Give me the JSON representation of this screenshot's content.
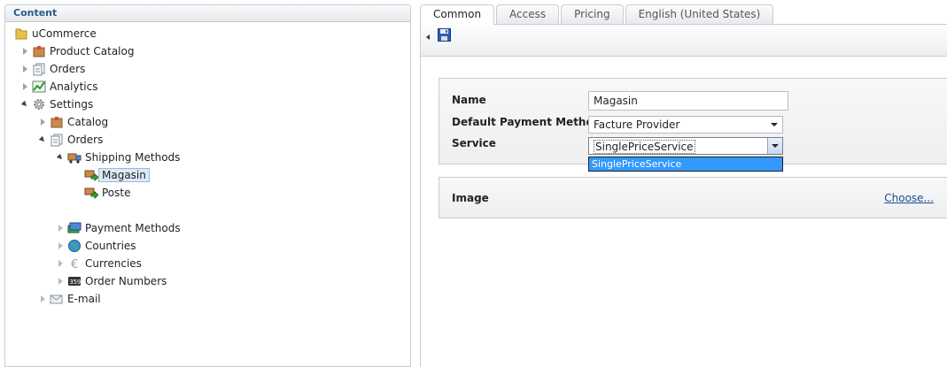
{
  "tree": {
    "header": "Content",
    "nodes": [
      {
        "label": "uCommerce"
      },
      {
        "label": "Product Catalog"
      },
      {
        "label": "Orders"
      },
      {
        "label": "Analytics"
      },
      {
        "label": "Settings"
      },
      {
        "label": "Catalog"
      },
      {
        "label": "Orders"
      },
      {
        "label": "Shipping Methods"
      },
      {
        "label": "Magasin"
      },
      {
        "label": "Poste"
      },
      {
        "label": "Payment Methods"
      },
      {
        "label": "Countries"
      },
      {
        "label": "Currencies"
      },
      {
        "label": "Order Numbers"
      },
      {
        "label": "E-mail"
      }
    ]
  },
  "tabs": [
    "Common",
    "Access",
    "Pricing",
    "English (United States)"
  ],
  "form": {
    "name_label": "Name",
    "name_value": "Magasin",
    "payment_label": "Default Payment Method",
    "payment_value": "Facture Provider",
    "service_label": "Service",
    "service_value": "SinglePriceService",
    "service_option": "SinglePriceService",
    "image_label": "Image",
    "choose_link": "Choose..."
  },
  "colors": {
    "accent": "#2a5a8a",
    "selection": "#3399ff"
  }
}
